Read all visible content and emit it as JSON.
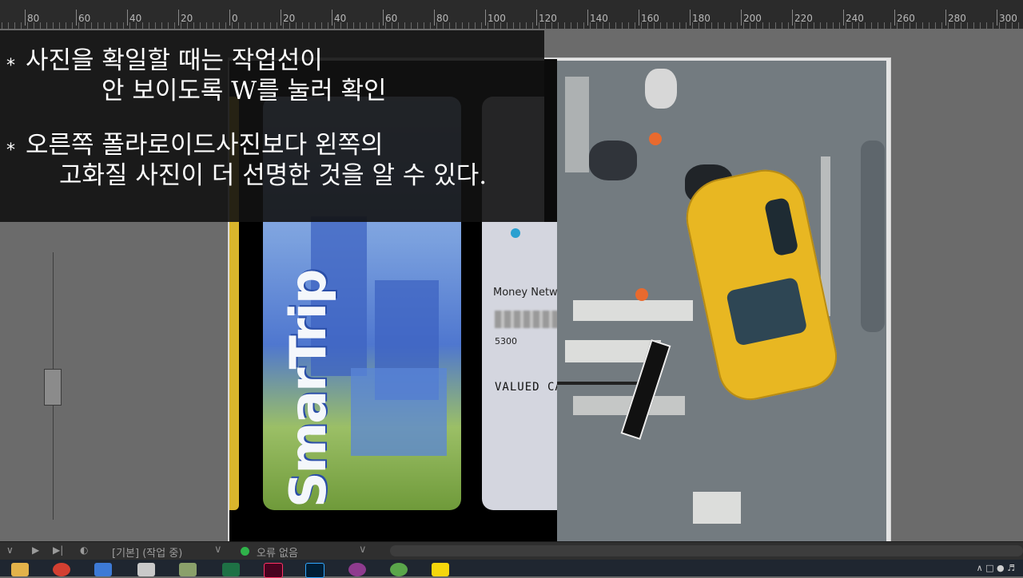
{
  "ruler": {
    "ticks": [
      "80",
      "60",
      "40",
      "20",
      "0",
      "20",
      "40",
      "60",
      "80",
      "100",
      "120",
      "140",
      "160",
      "180",
      "200",
      "220",
      "240",
      "260",
      "280",
      "300"
    ]
  },
  "overlay": {
    "star": "*",
    "note1_line1": "사진을 확일할 때는 작업선이",
    "note1_line2": "안 보이도록 W를 눌러 확인",
    "note2_line1": "오른쪽 폴라로이드사진보다 왼쪽의",
    "note2_line2": "고화질 사진이 더 선명한 것을 알 수 있다."
  },
  "card": {
    "smartrip": "SmarTrip",
    "money_network": "Money Netwo",
    "number": "5300",
    "valued": "VALUED CAR"
  },
  "statusbar": {
    "preset": "[기본] (작업 중)",
    "preflight": "오류 없음"
  },
  "taskbar": {
    "apps": [
      "file-explorer",
      "chrome",
      "photos",
      "store",
      "paint",
      "excel",
      "indesign",
      "photoshop",
      "app",
      "app2",
      "kakaotalk"
    ]
  },
  "colors": {
    "preflight_ok": "#2fb34a",
    "taxi": "#e8b722"
  }
}
